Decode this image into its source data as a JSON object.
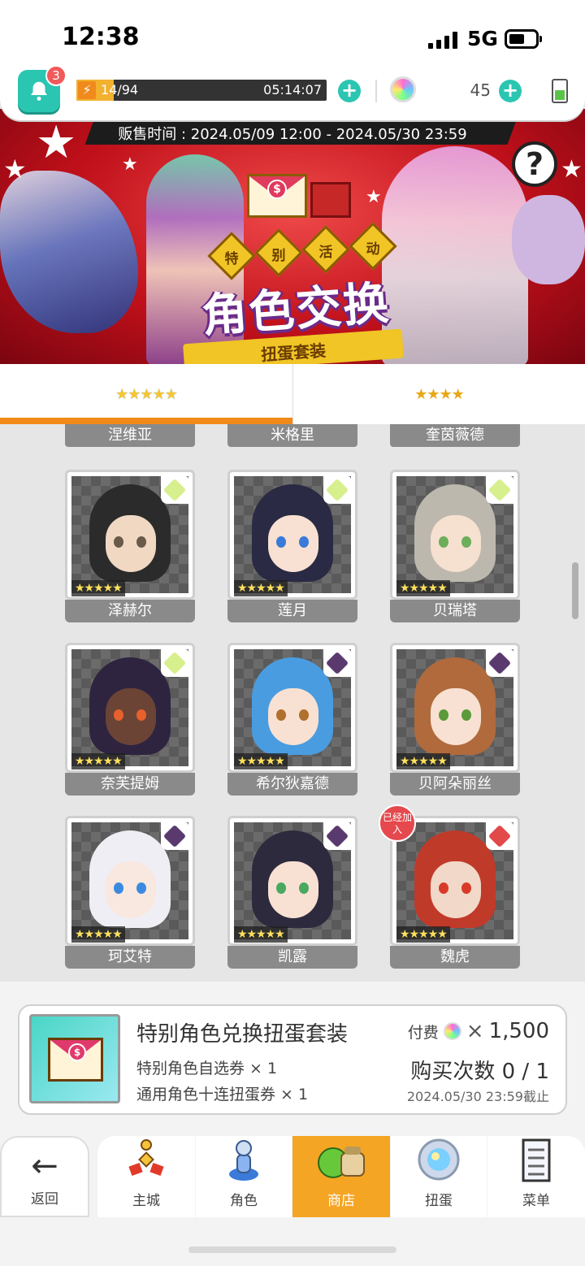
{
  "status_bar": {
    "time": "12:38",
    "network": "5G"
  },
  "resources": {
    "notifications": "3",
    "energy_text": "14/94",
    "energy_fraction": 0.149,
    "energy_timer": "05:14:07",
    "gems": "45"
  },
  "banner": {
    "sale_time": "贩售时间 : 2024.05/09 12:00 - 2024.05/30 23:59",
    "event_chars": [
      "特",
      "别",
      "活",
      "动"
    ],
    "title": "角色交换",
    "subtitle": "扭蛋套装"
  },
  "tabs": [
    {
      "stars": "★★★★★",
      "active": true
    },
    {
      "stars": "★★★★",
      "active": false
    }
  ],
  "partial_row": [
    "涅维亚",
    "米格里",
    "奎茵薇德"
  ],
  "characters": [
    {
      "name": "泽赫尔",
      "stars": "★★★★★",
      "element": "light",
      "hair": "#2b2b2b",
      "eye": "#6a5a4a",
      "skin": "#f1d8c2"
    },
    {
      "name": "莲月",
      "stars": "★★★★★",
      "element": "light",
      "hair": "#2a2a44",
      "eye": "#3a7ad8",
      "skin": "#f8e1d2"
    },
    {
      "name": "贝瑞塔",
      "stars": "★★★★★",
      "element": "light",
      "hair": "#bdb8ae",
      "eye": "#6cae5a",
      "skin": "#f6e0d0"
    },
    {
      "name": "奈芙提姆",
      "stars": "★★★★★",
      "element": "light",
      "hair": "#2e2440",
      "eye": "#e8602c",
      "skin": "#6b4436"
    },
    {
      "name": "希尔狄嘉德",
      "stars": "★★★★★",
      "element": "dark",
      "hair": "#4a9ce0",
      "eye": "#b0702e",
      "skin": "#f8e1d2"
    },
    {
      "name": "贝阿朵丽丝",
      "stars": "★★★★★",
      "element": "dark",
      "hair": "#b06a3c",
      "eye": "#5a9a3a",
      "skin": "#f8e1d2"
    },
    {
      "name": "珂艾特",
      "stars": "★★★★★",
      "element": "dark",
      "hair": "#eeeef4",
      "eye": "#3a8ae0",
      "skin": "#f8e8e0"
    },
    {
      "name": "凯露",
      "stars": "★★★★★",
      "element": "dark",
      "hair": "#2e2a3e",
      "eye": "#4aa860",
      "skin": "#f8e1d2"
    },
    {
      "name": "魏虎",
      "stars": "★★★★★",
      "element": "fire",
      "hair": "#c03a2a",
      "eye": "#d83a2a",
      "skin": "#f1d8c8",
      "owned": "已经加入"
    }
  ],
  "colors": {
    "light": "#d7ef8c",
    "dark": "#5a3a6e",
    "fire": "#e24a4a",
    "accent": "#2bc6b2",
    "tab_active": "#f28a1a"
  },
  "package": {
    "title": "特别角色兑换扭蛋套装",
    "item1": "特别角色自选券 × 1",
    "item2": "通用角色十连扭蛋券 × 1",
    "price_label": "付费",
    "price_mult": "×",
    "price_amount": "1,500",
    "purchase_count": "购买次数 0 / 1",
    "deadline": "2024.05/30 23:59截止"
  },
  "nav": {
    "back": "返回",
    "items": [
      "主城",
      "角色",
      "商店",
      "扭蛋",
      "菜单"
    ],
    "active_index": 2
  }
}
